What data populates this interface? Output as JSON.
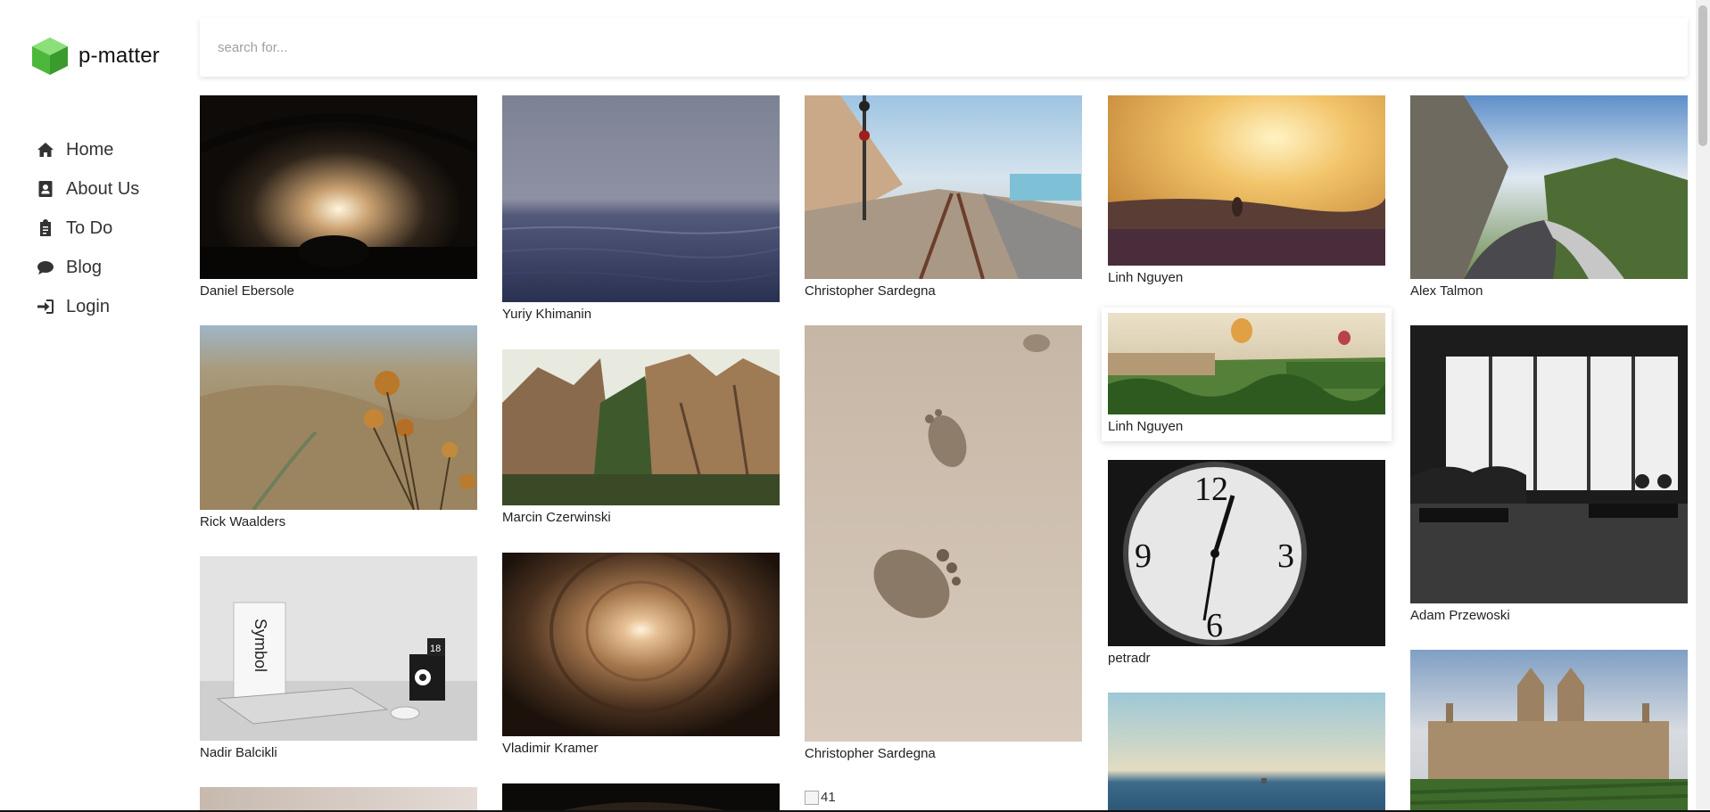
{
  "brand": {
    "name": "p-matter",
    "logo_icon": "cube-logo-icon"
  },
  "nav": {
    "items": [
      {
        "label": "Home",
        "icon": "home-icon"
      },
      {
        "label": "About Us",
        "icon": "address-card-icon"
      },
      {
        "label": "To Do",
        "icon": "clipboard-icon"
      },
      {
        "label": "Blog",
        "icon": "comment-icon"
      },
      {
        "label": "Login",
        "icon": "sign-in-icon"
      }
    ]
  },
  "search": {
    "placeholder": "search for...",
    "value": ""
  },
  "gallery": {
    "columns": [
      {
        "cards": [
          {
            "author": "Daniel Ebersole",
            "scene": "concert"
          },
          {
            "author": "Rick Waalders",
            "scene": "thistle-valley"
          },
          {
            "author": "Nadir Balcikli",
            "scene": "desk-laptop"
          },
          {
            "author": "",
            "scene": "partial-light"
          }
        ]
      },
      {
        "cards": [
          {
            "author": "Yuriy Khimanin",
            "scene": "foggy-sea"
          },
          {
            "author": "Marcin Czerwinski",
            "scene": "rocks"
          },
          {
            "author": "Vladimir Kramer",
            "scene": "tunnel"
          },
          {
            "author": "",
            "scene": "partial-dark"
          }
        ]
      },
      {
        "cards": [
          {
            "author": "Christopher Sardegna",
            "scene": "railway"
          },
          {
            "author": "Christopher Sardegna",
            "scene": "footprints"
          }
        ],
        "broken_image_alt": "41"
      },
      {
        "cards": [
          {
            "author": "Linh Nguyen",
            "scene": "sunset-runner"
          },
          {
            "author": "Linh Nguyen",
            "scene": "balloons"
          },
          {
            "author": "petradr",
            "scene": "clock"
          },
          {
            "author": "",
            "scene": "sea-horizon"
          }
        ]
      },
      {
        "cards": [
          {
            "author": "Alex Talmon",
            "scene": "mountain-road"
          },
          {
            "author": "Adam Przewoski",
            "scene": "library"
          },
          {
            "author": "",
            "scene": "college"
          }
        ]
      }
    ]
  },
  "colors": {
    "logo_green": "#5cc94a",
    "text": "#222222",
    "placeholder": "#a0a0a0"
  }
}
